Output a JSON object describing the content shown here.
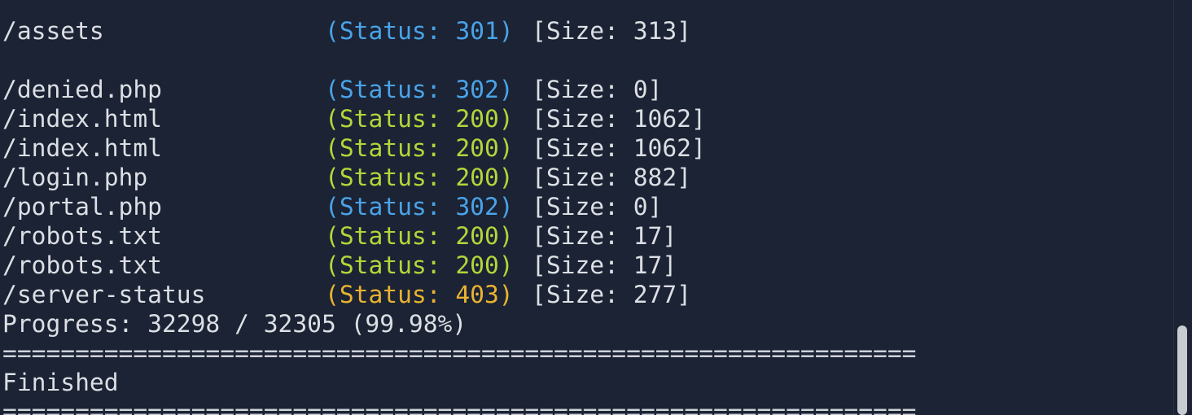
{
  "terminal": {
    "lines": [
      {
        "path": "/assets",
        "status": "(Status: 301)",
        "size": "[Size: 313]",
        "color": "blue"
      },
      {
        "path": "",
        "status": "",
        "size": "",
        "color": "none"
      },
      {
        "path": "/denied.php",
        "status": "(Status: 302)",
        "size": "[Size: 0]",
        "color": "blue"
      },
      {
        "path": "/index.html",
        "status": "(Status: 200)",
        "size": "[Size: 1062]",
        "color": "green"
      },
      {
        "path": "/index.html",
        "status": "(Status: 200)",
        "size": "[Size: 1062]",
        "color": "green"
      },
      {
        "path": "/login.php",
        "status": "(Status: 200)",
        "size": "[Size: 882]",
        "color": "green"
      },
      {
        "path": "/portal.php",
        "status": "(Status: 302)",
        "size": "[Size: 0]",
        "color": "blue"
      },
      {
        "path": "/robots.txt",
        "status": "(Status: 200)",
        "size": "[Size: 17]",
        "color": "green"
      },
      {
        "path": "/robots.txt",
        "status": "(Status: 200)",
        "size": "[Size: 17]",
        "color": "green"
      },
      {
        "path": "/server-status",
        "status": "(Status: 403)",
        "size": "[Size: 277]",
        "color": "orange"
      }
    ],
    "progress": "Progress: 32298 / 32305 (99.98%)",
    "separator": "===============================================================",
    "finished": "Finished",
    "separator2": "===============================================================",
    "colors": {
      "background": "#1b2334",
      "text": "#dcdfe4",
      "status_301_302": "#4aa3e8",
      "status_200": "#b5d53a",
      "status_403": "#e9b330"
    }
  },
  "scrollbar": {
    "position_fraction": 0.78
  }
}
